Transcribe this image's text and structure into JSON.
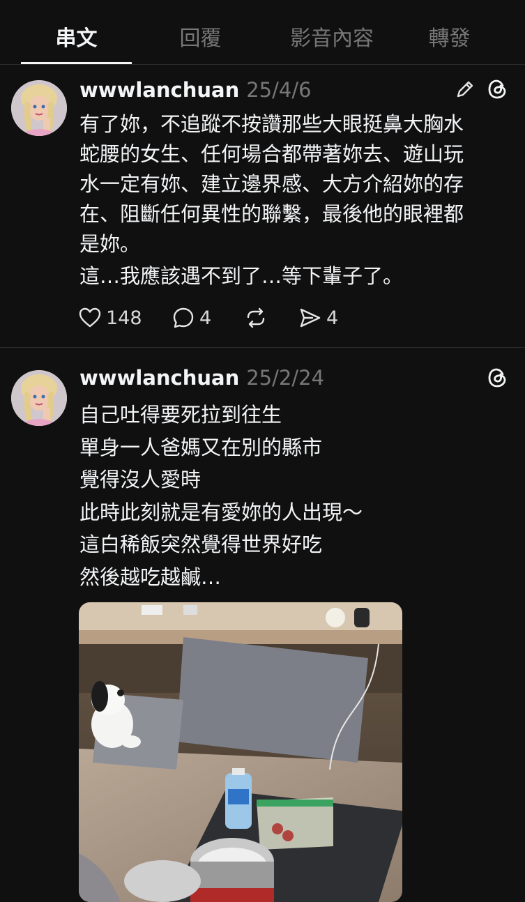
{
  "tabs": [
    {
      "label": "串文",
      "active": true
    },
    {
      "label": "回覆",
      "active": false
    },
    {
      "label": "影音內容",
      "active": false
    },
    {
      "label": "轉發",
      "active": false
    }
  ],
  "posts": [
    {
      "username": "wwwlanchuan",
      "date": "25/4/6",
      "lines": [
        "有了妳，不追蹤不按讚那些大眼挺鼻大胸水",
        "蛇腰的女生、任何場合都帶著妳去、遊山玩",
        "水一定有妳、建立邊界感、大方介紹妳的存",
        "在、阻斷任何異性的聯繫，最後他的眼裡都",
        "是妳。",
        "這…我應該遇不到了…等下輩子了。"
      ],
      "likes": "148",
      "comments": "4",
      "shares": "4",
      "icons": [
        "pencil-icon",
        "threads-icon",
        "heart-icon",
        "comment-icon",
        "repost-icon",
        "send-icon"
      ]
    },
    {
      "username": "wwwlanchuan",
      "date": "25/2/24",
      "lines": [
        "自己吐得要死拉到往生",
        "單身一人爸媽又在別的縣市",
        "覺得沒人愛時",
        "此時此刻就是有愛妳的人出現～",
        "這白稀飯突然覺得世界好吃",
        "然後越吃越鹹…"
      ],
      "icons": [
        "threads-icon"
      ]
    }
  ],
  "colors": {
    "background": "#101010",
    "text": "#f3f5f7",
    "muted": "#777777",
    "divider": "#2a2a2a"
  }
}
